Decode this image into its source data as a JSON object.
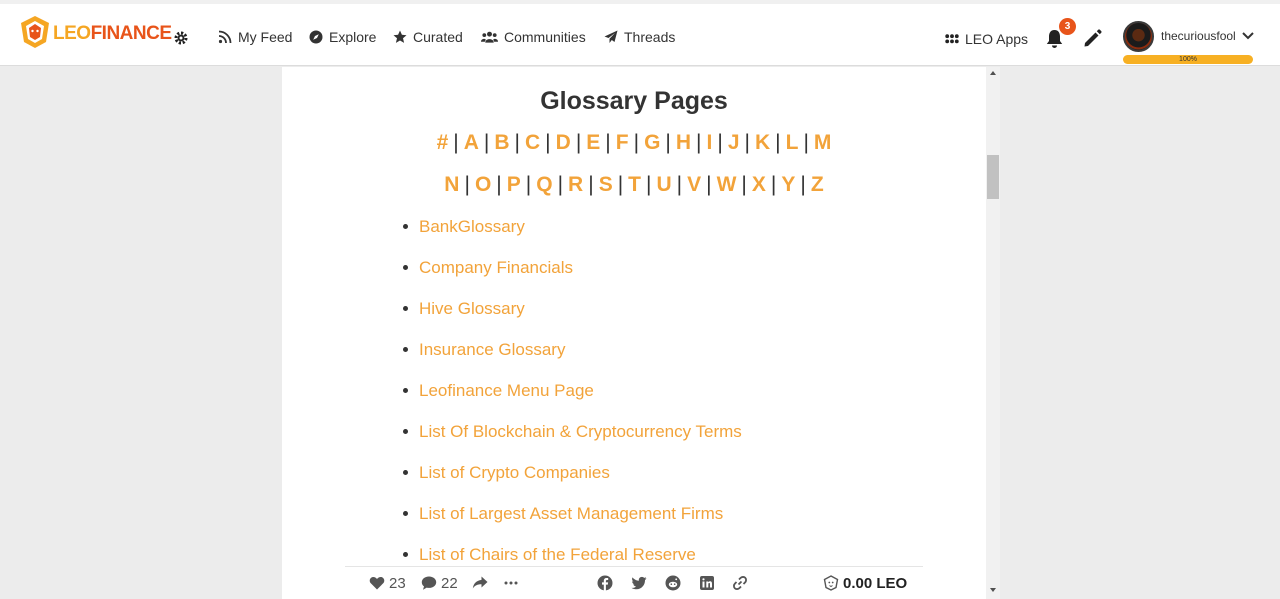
{
  "header": {
    "brand_leo": "LEO",
    "brand_finance": "FINANCE",
    "nav": [
      "My Feed",
      "Explore",
      "Curated",
      "Communities",
      "Threads"
    ],
    "apps_label": "LEO Apps",
    "notification_count": "3",
    "username": "thecuriousfool",
    "progress_label": "100%",
    "progress_value": 100
  },
  "content": {
    "title": "Glossary Pages",
    "letters_row1": [
      "#",
      "A",
      "B",
      "C",
      "D",
      "E",
      "F",
      "G",
      "H",
      "I",
      "J",
      "K",
      "L",
      "M"
    ],
    "letters_row2": [
      "N",
      "O",
      "P",
      "Q",
      "R",
      "S",
      "T",
      "U",
      "V",
      "W",
      "X",
      "Y",
      "Z"
    ],
    "items": [
      "BankGlossary",
      "Company Financials",
      "Hive Glossary",
      "Insurance Glossary",
      "Leofinance Menu Page",
      "List Of Blockchain & Cryptocurrency Terms",
      "List of Crypto Companies",
      "List of Largest Asset Management Firms",
      "List of Chairs of the Federal Reserve"
    ]
  },
  "footer": {
    "likes": "23",
    "comments": "22",
    "payout": "0.00 LEO"
  },
  "colors": {
    "accent": "#f2a33a",
    "brand_orange": "#e8541a",
    "progress": "#f7b023"
  }
}
